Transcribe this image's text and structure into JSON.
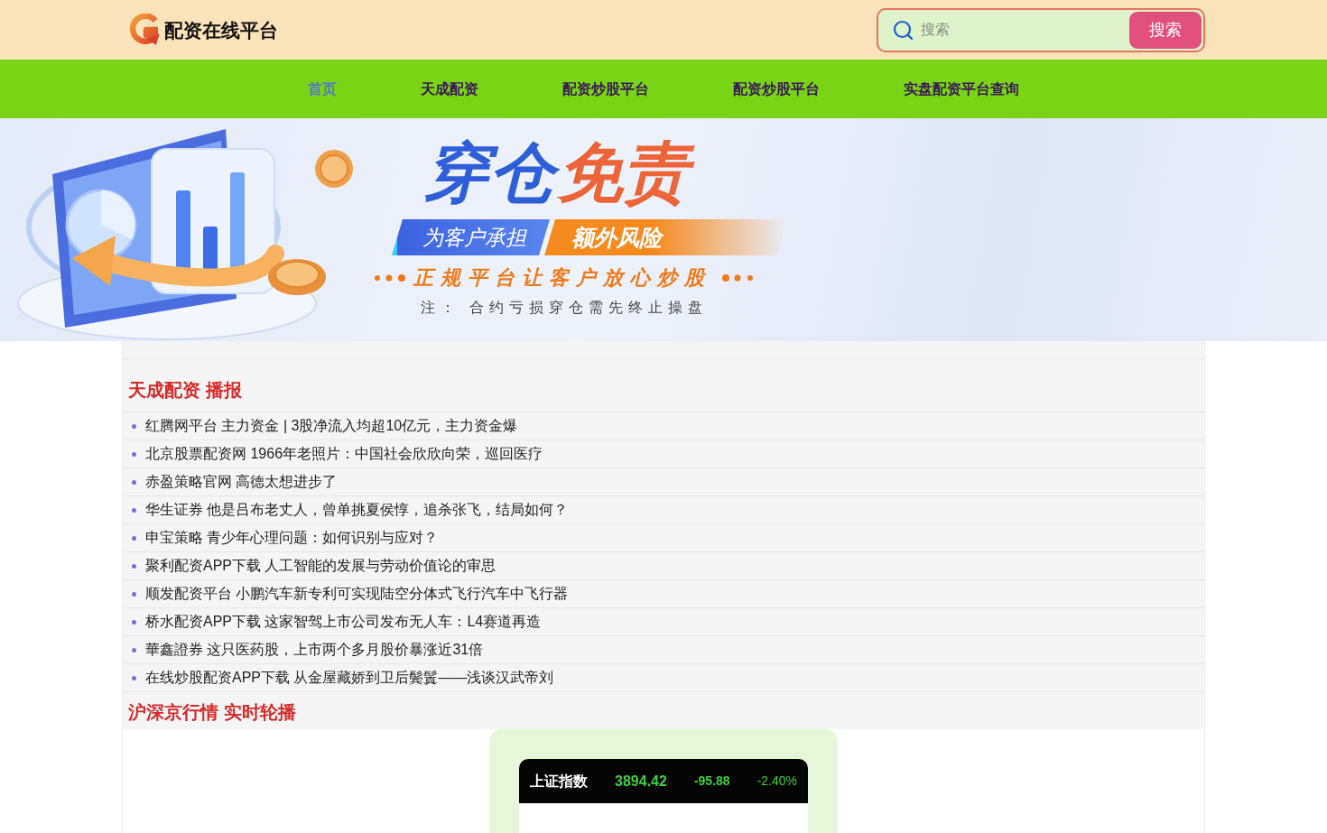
{
  "header": {
    "logo_text": "配资在线平台",
    "search": {
      "placeholder": "搜索",
      "button": "搜索"
    }
  },
  "nav": [
    {
      "label": "首页",
      "selected": true
    },
    {
      "label": "天成配资",
      "selected": false
    },
    {
      "label": "配资炒股平台",
      "selected": false
    },
    {
      "label": "配资炒股平台",
      "selected": false
    },
    {
      "label": "实盘配资平台查询",
      "selected": false
    }
  ],
  "banner": {
    "headline": [
      {
        "text": "穿仓",
        "color": "#2f5fd8"
      },
      {
        "text": "免责",
        "color": "#ec6438"
      }
    ],
    "ribbons": [
      {
        "text": "为客户承担",
        "color": "#3b63e0"
      },
      {
        "text": "额外风险",
        "color": "#f58a1f"
      }
    ],
    "slogan": "正规平台让客户放心炒股",
    "note": "注： 合约亏损穿仓需先终止操盘"
  },
  "news": {
    "title": "天成配资 播报",
    "items": [
      "红腾网平台 主力资金 | 3股净流入均超10亿元，主力资金爆",
      "北京股票配资网 1966年老照片：中国社会欣欣向荣，巡回医疗",
      "赤盈策略官网 高德太想进步了",
      "华生证券 他是吕布老丈人，曾单挑夏侯惇，追杀张飞，结局如何？",
      "申宝策略 青少年心理问题：如何识别与应对？",
      "聚利配资APP下载 人工智能的发展与劳动价值论的审思",
      "顺发配资平台 小鹏汽车新专利可实现陆空分体式飞行汽车中飞行器",
      "桥水配资APP下载 这家智驾上市公司发布无人车：L4赛道再造",
      "華鑫證券 这只医药股，上市两个多月股价暴涨近31倍",
      "在线炒股配资APP下载 从金屋藏娇到卫后鬓鬒——浅谈汉武帝刘"
    ]
  },
  "quotes": {
    "title": "沪深京行情 实时轮播",
    "ticker": {
      "name": "上证指数",
      "price": "3894.42",
      "change": "-95.88",
      "percent": "-2.40%"
    }
  }
}
